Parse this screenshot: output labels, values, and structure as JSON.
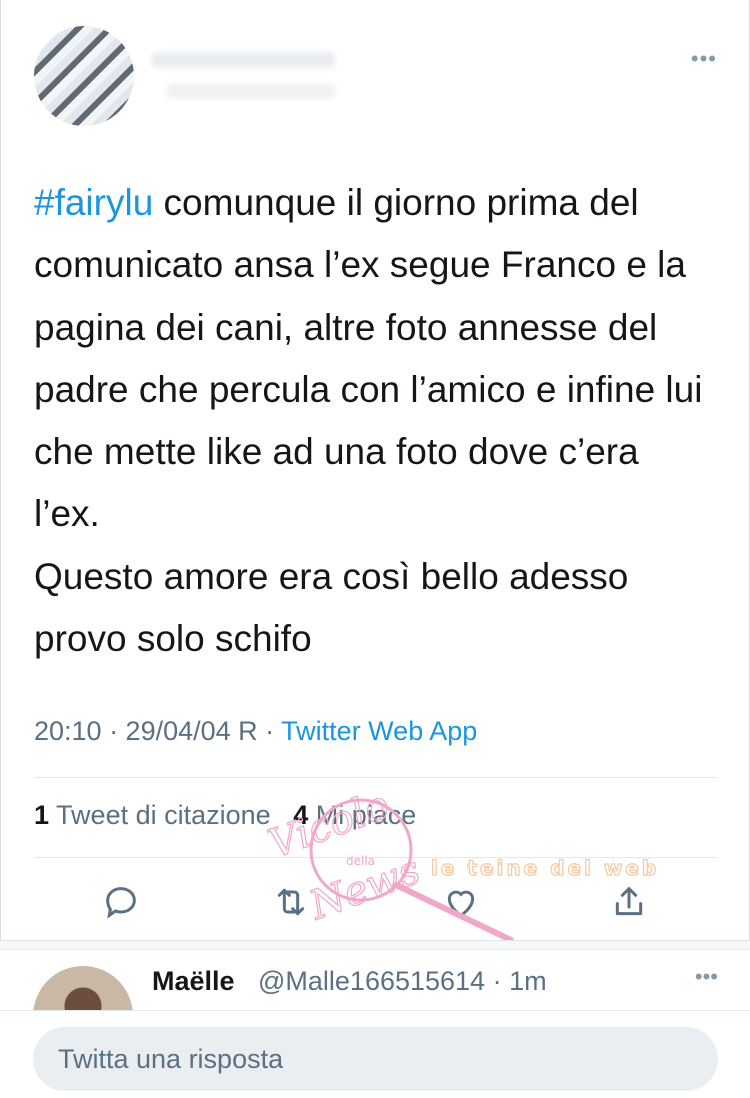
{
  "tweet": {
    "hashtag": "#fairylu",
    "body": " comunque il giorno prima del comunicato ansa l’ex segue Franco e la pagina dei cani, altre foto annesse del padre che percula con l’amico e infine lui che mette like ad una foto dove c’era l’ex.\nQuesto amore era così bello adesso provo solo schifo",
    "time": "20:10 · 29/04/04 R · ",
    "via": "Twitter Web App",
    "quote_count": "1",
    "quote_label": "Tweet di citazione",
    "likes_count": "4",
    "likes_label": "Mi piace",
    "more_icon": "•••"
  },
  "actions": {
    "reply_icon": "reply-icon",
    "retweet_icon": "retweet-icon",
    "like_icon": "heart-icon",
    "share_icon": "share-icon"
  },
  "reply": {
    "name": "Maëlle",
    "handle": "@Malle166515614 · 1m",
    "more_icon": "•••"
  },
  "compose": {
    "placeholder": "Twitta una risposta"
  },
  "watermark": {
    "line1": "Vicolo",
    "line2": "della",
    "line3": "News",
    "brand": "le teine del web"
  },
  "colors": {
    "accent": "#1b95e0",
    "secondary_text": "#5b7083",
    "watermark_pink": "#f0a7c8"
  }
}
